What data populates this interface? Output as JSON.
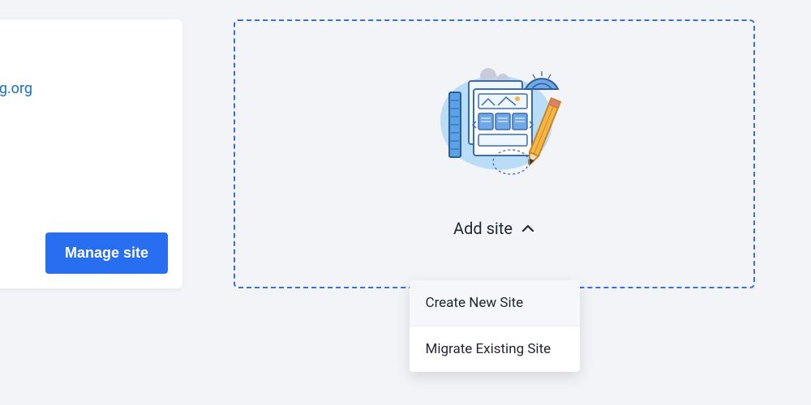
{
  "site_card": {
    "domain_fragment": "g.org",
    "manage_label": "Manage site"
  },
  "add_site": {
    "trigger_label": "Add site",
    "menu": {
      "create_label": "Create New Site",
      "migrate_label": "Migrate Existing Site"
    }
  }
}
